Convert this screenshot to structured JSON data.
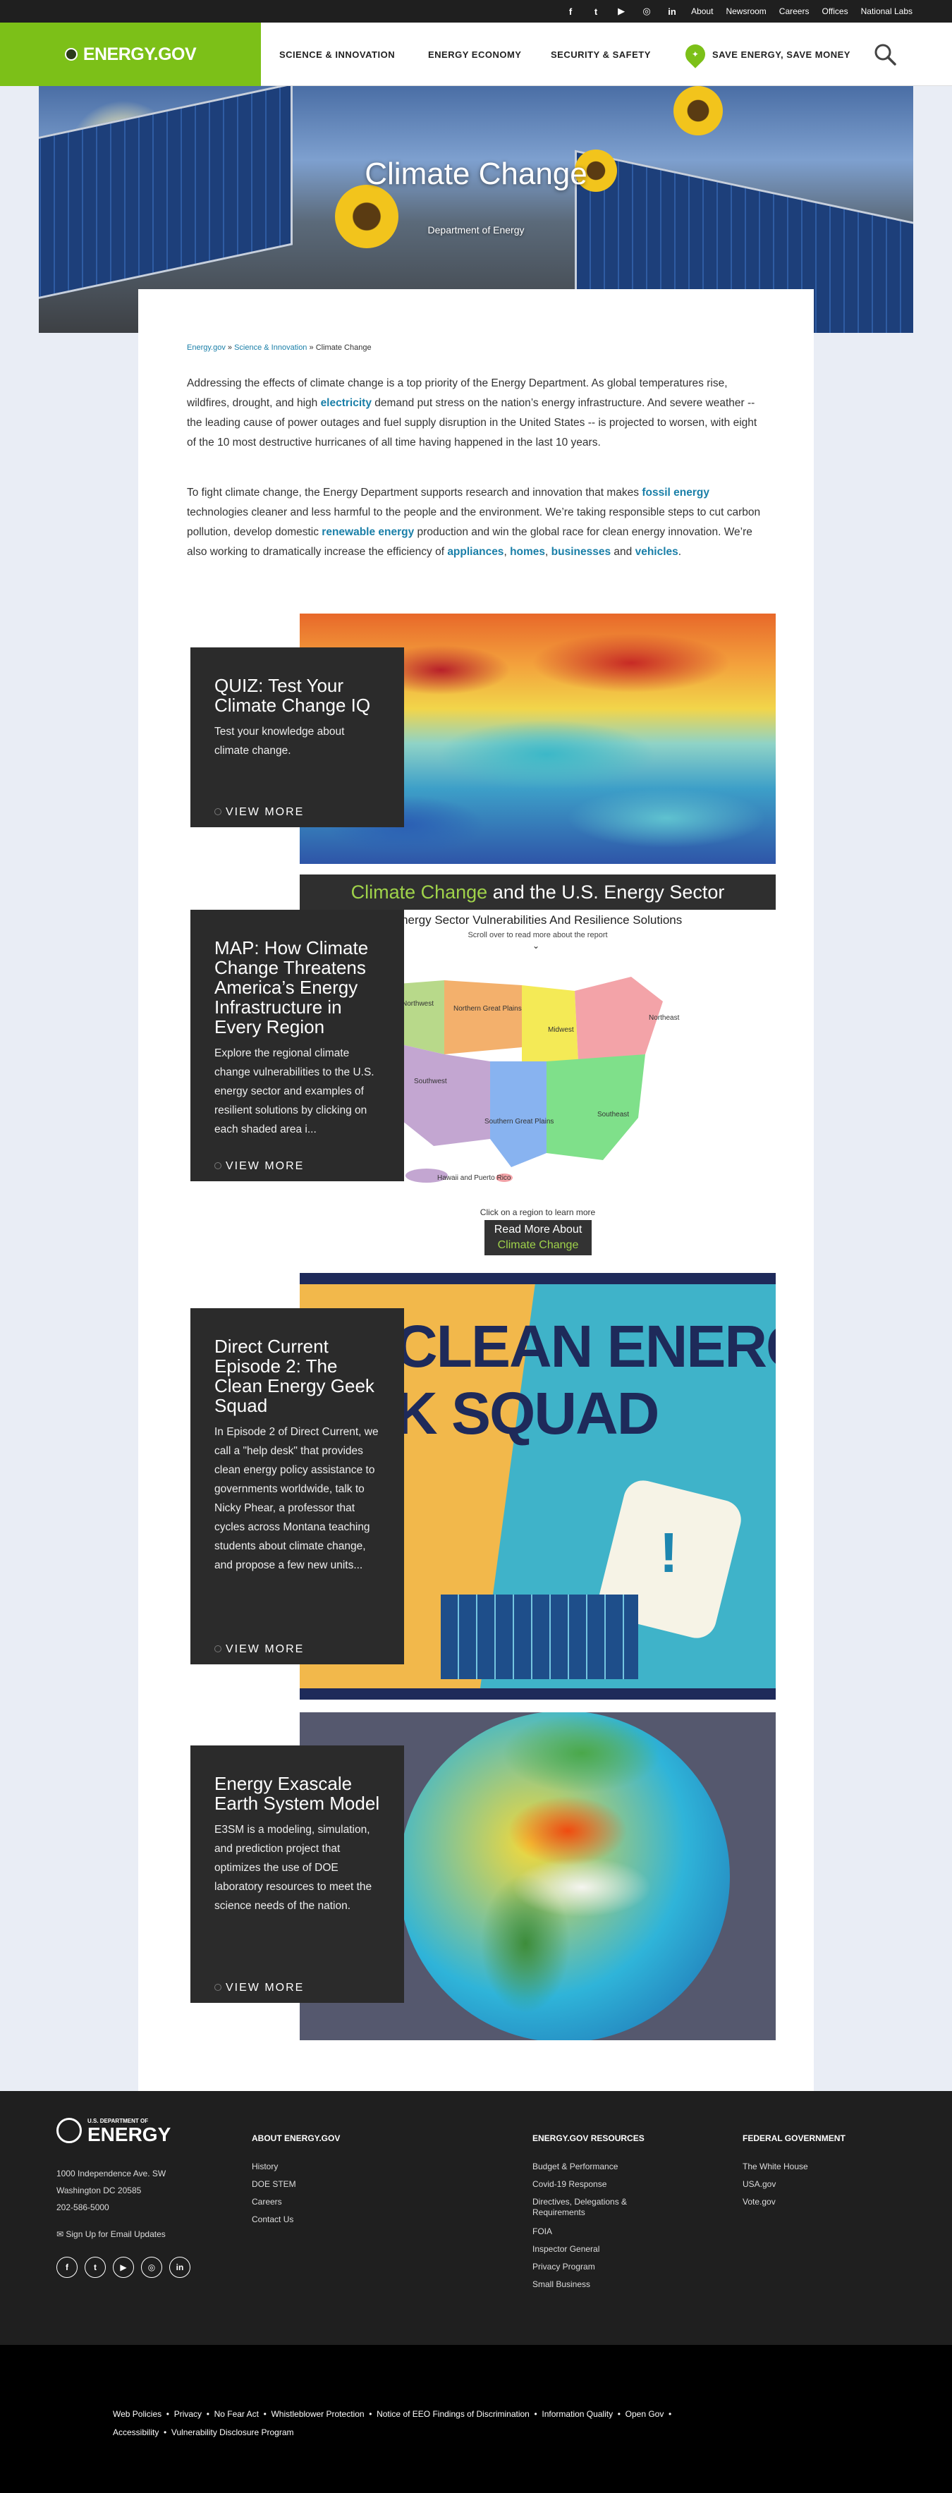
{
  "utility": {
    "social": [
      "f",
      "t",
      "▶",
      "◎",
      "in"
    ],
    "links": [
      "About",
      "Newsroom",
      "Careers",
      "Offices",
      "National Labs"
    ]
  },
  "header": {
    "logo": "ENERGY.GOV",
    "nav": [
      "SCIENCE & INNOVATION",
      "ENERGY ECONOMY",
      "SECURITY & SAFETY",
      "SAVE ENERGY, SAVE MONEY"
    ]
  },
  "hero": {
    "title": "Climate Change",
    "subtitle": "Department of Energy"
  },
  "breadcrumb": {
    "home": "Energy.gov",
    "section": "Science & Innovation",
    "current": "Climate Change",
    "sep": "»"
  },
  "intro": {
    "p1_a": "Addressing the effects of climate change is a top priority of the Energy Department. As global temperatures rise, wildfires, drought, and high ",
    "p1_link": "electricity",
    "p1_b": " demand put stress on the nation’s energy infrastructure. And severe weather -- the leading cause of power outages and fuel supply disruption in the United States -- is projected to worsen, with eight of the 10 most destructive hurricanes of all time having happened in the last 10 years.",
    "p2_a": "To fight climate change, the Energy Department supports research and innovation that makes ",
    "p2_link1": "fossil energy",
    "p2_b": " technologies cleaner and less harmful to the people and the environment. We’re taking responsible steps to cut carbon pollution, develop domestic ",
    "p2_link2": "renewable energy",
    "p2_c": " production and win the global race for clean energy innovation. We’re also working to dramatically increase the efficiency of ",
    "p2_link3": "appliances",
    "p2_link4": "homes",
    "p2_link5": "businesses",
    "p2_and": " and ",
    "p2_link6": "vehicles",
    "p2_end": "."
  },
  "features": [
    {
      "title": "QUIZ: Test Your Climate Change IQ",
      "text": "Test your knowledge about climate change.",
      "cta": "VIEW MORE"
    },
    {
      "title": "MAP: How Climate Change Threatens America’s Energy Infrastructure in Every Region",
      "text": "Explore the regional climate change vulnerabilities to the U.S. energy sector and examples of resilient solutions by clicking on each shaded area i...",
      "cta": "VIEW MORE"
    },
    {
      "title": "Direct Current Episode 2: The Clean Energy Geek Squad",
      "text": "In Episode 2 of Direct Current, we call a \"help desk\" that provides clean energy policy assistance to governments worldwide, talk to Nicky Phear, a professor that cycles across Montana teaching students about climate change, and propose a few new units...",
      "cta": "VIEW MORE"
    },
    {
      "title": "Energy Exascale Earth System Model",
      "text": "E3SM is a modeling, simulation, and prediction project that optimizes the use of DOE laboratory resources to meet the science needs of the nation.",
      "cta": "VIEW MORE"
    }
  ],
  "map_graphic": {
    "banner_green": "Climate Change",
    "banner_white": " and the U.S. Energy Sector",
    "subtitle": "Energy Sector Vulnerabilities And Resilience Solutions",
    "scroll": "Scroll over to read more about the report",
    "regions": [
      "Northwest",
      "Northern Great Plains",
      "Midwest",
      "Northeast",
      "Southwest",
      "Southern Great Plains",
      "Southeast",
      "Hawaii and Puerto Rico"
    ],
    "click": "Click on a region to learn more",
    "btn1": "Read More About",
    "btn2": "Climate Change"
  },
  "geek_graphic": {
    "line1": "CLEAN ENERGY",
    "line2": "K SQUAD"
  },
  "footer": {
    "logo_small": "U.S. DEPARTMENT OF",
    "logo_big": "ENERGY",
    "address": [
      "1000 Independence Ave. SW",
      "Washington DC 20585",
      "202-586-5000"
    ],
    "email": "Sign Up for Email Updates",
    "about_h": "ABOUT ENERGY.GOV",
    "about": [
      "History",
      "DOE STEM",
      "Careers",
      "Contact Us"
    ],
    "res_h": "ENERGY.GOV RESOURCES",
    "res": [
      "Budget & Performance",
      "Covid-19 Response",
      "Directives, Delegations &",
      "Requirements",
      "FOIA",
      "Inspector General",
      "Privacy Program",
      "Small Business"
    ],
    "fed_h": "FEDERAL GOVERNMENT",
    "fed": [
      "The White House",
      "USA.gov",
      "Vote.gov"
    ],
    "social": [
      "f",
      "t",
      "▶",
      "◎",
      "in"
    ]
  },
  "bottom_links": [
    "Web Policies",
    "Privacy",
    "No Fear Act",
    "Whistleblower Protection",
    "Notice of EEO Findings of Discrimination",
    "Information Quality",
    "Open Gov",
    "Accessibility",
    "Vulnerability Disclosure Program"
  ],
  "colors": {
    "brand_green": "#7cc018",
    "link": "#1a7fa8",
    "dark": "#2b2b2b"
  }
}
